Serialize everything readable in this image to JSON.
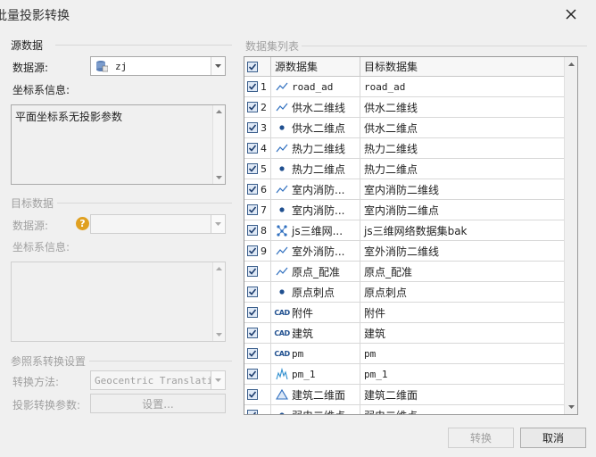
{
  "window": {
    "title": "批量投影转换"
  },
  "source": {
    "section_title": "源数据",
    "datasource_label": "数据源:",
    "datasource_value": "zj",
    "coord_label": "坐标系信息:",
    "coord_info": "平面坐标系无投影参数"
  },
  "target": {
    "section_title": "目标数据",
    "datasource_label": "数据源:",
    "datasource_value": "",
    "coord_label": "坐标系信息:",
    "coord_info": ""
  },
  "reference": {
    "section_title": "参照系转换设置",
    "method_label": "转换方法:",
    "method_value": "Geocentric Translati",
    "params_label": "投影转换参数:",
    "settings_button": "设置..."
  },
  "dataset_list": {
    "title": "数据集列表",
    "col_source": "源数据集",
    "col_target": "目标数据集",
    "rows": [
      {
        "num": "1",
        "icon": "line-icon",
        "source": "road_ad",
        "target": "road_ad",
        "mono": true
      },
      {
        "num": "2",
        "icon": "line-icon",
        "source": "供水二维线",
        "target": "供水二维线",
        "mono": false
      },
      {
        "num": "3",
        "icon": "point-icon",
        "source": "供水二维点",
        "target": "供水二维点",
        "mono": false
      },
      {
        "num": "4",
        "icon": "line-icon",
        "source": "热力二维线",
        "target": "热力二维线",
        "mono": false
      },
      {
        "num": "5",
        "icon": "point-icon",
        "source": "热力二维点",
        "target": "热力二维点",
        "mono": false
      },
      {
        "num": "6",
        "icon": "line-icon",
        "source": "室内消防...",
        "target": "室内消防二维线",
        "mono": false
      },
      {
        "num": "7",
        "icon": "point-icon",
        "source": "室内消防...",
        "target": "室内消防二维点",
        "mono": false
      },
      {
        "num": "8",
        "icon": "network-icon",
        "source": "js三维网...",
        "target": "js三维网络数据集bak",
        "mono": false
      },
      {
        "num": "9",
        "icon": "line-icon",
        "source": "室外消防...",
        "target": "室外消防二维线",
        "mono": false
      },
      {
        "num": "",
        "icon": "line-icon",
        "source": "原点_配准",
        "target": "原点_配准",
        "mono": false
      },
      {
        "num": "",
        "icon": "point-icon",
        "source": "原点刺点",
        "target": "原点刺点",
        "mono": false
      },
      {
        "num": "",
        "icon": "cad-icon",
        "source": "附件",
        "target": "附件",
        "mono": false
      },
      {
        "num": "",
        "icon": "cad-icon",
        "source": "建筑",
        "target": "建筑",
        "mono": false
      },
      {
        "num": "",
        "icon": "cad-icon",
        "source": "pm",
        "target": "pm",
        "mono": true
      },
      {
        "num": "",
        "icon": "grid-icon",
        "source": "pm_1",
        "target": "pm_1",
        "mono": true
      },
      {
        "num": "",
        "icon": "region-icon",
        "source": "建筑二维面",
        "target": "建筑二维面",
        "mono": false
      },
      {
        "num": "",
        "icon": "point-icon",
        "source": "弱电二维点",
        "target": "弱电二维点",
        "mono": false
      }
    ]
  },
  "buttons": {
    "convert": "转换",
    "cancel": "取消"
  },
  "icons": {
    "cad_text": "CAD"
  },
  "colors": {
    "accent": "#1f5fae",
    "check_border": "#3b5f8c",
    "help_icon": "#e0a020"
  }
}
